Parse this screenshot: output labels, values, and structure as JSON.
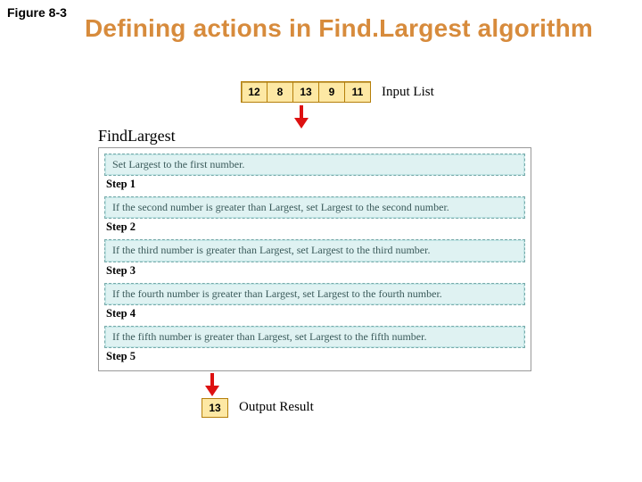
{
  "figure_label": "Figure 8-3",
  "title": "Defining actions in Find.Largest algorithm",
  "input": {
    "values": [
      "12",
      "8",
      "13",
      "9",
      "11"
    ],
    "label": "Input List"
  },
  "algo_name": "FindLargest",
  "steps": [
    {
      "text": "Set Largest to the  first number.",
      "label": "Step 1"
    },
    {
      "text": "If the second number is greater than Largest, set Largest to the second number.",
      "label": "Step 2"
    },
    {
      "text": "If the third number is greater than Largest, set Largest to the third number.",
      "label": "Step 3"
    },
    {
      "text": "If the fourth number is greater than Largest, set Largest to the fourth number.",
      "label": "Step 4"
    },
    {
      "text": "If the  fifth number is greater than Largest, set Largest to the  fifth number.",
      "label": "Step 5"
    }
  ],
  "output": {
    "value": "13",
    "label": "Output Result"
  }
}
